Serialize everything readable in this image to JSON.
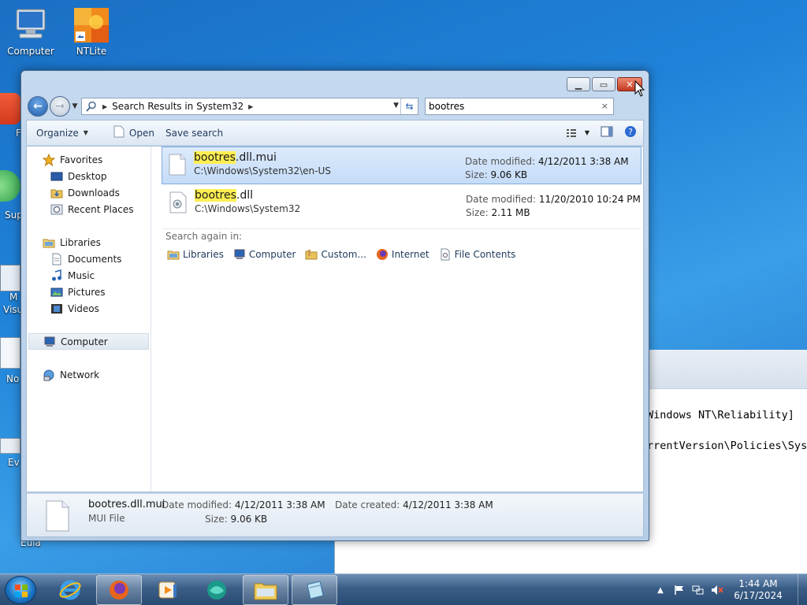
{
  "desktop": {
    "icons": [
      {
        "label": "Computer"
      },
      {
        "label": "NTLite"
      }
    ],
    "partial_labels": [
      "F",
      "Sup",
      "M",
      "Visu",
      "No",
      "Ev",
      "Eula"
    ]
  },
  "console": {
    "lines": [
      "Windows NT\\Reliability]",
      "rrentVersion\\Policies\\Sys"
    ]
  },
  "explorer": {
    "address": {
      "breadcrumb": "Search Results in System32"
    },
    "search": {
      "value": "bootres",
      "clear_glyph": "×"
    },
    "toolbar": {
      "organize": "Organize",
      "open": "Open",
      "save_search": "Save search"
    },
    "nav": {
      "favorites": "Favorites",
      "favorites_items": [
        "Desktop",
        "Downloads",
        "Recent Places"
      ],
      "libraries": "Libraries",
      "libraries_items": [
        "Documents",
        "Music",
        "Pictures",
        "Videos"
      ],
      "computer": "Computer",
      "network": "Network"
    },
    "results": [
      {
        "name_match": "bootres",
        "name_rest": ".dll.mui",
        "path": "C:\\Windows\\System32\\en-US",
        "date_label": "Date modified:",
        "date": "4/12/2011 3:38 AM",
        "size_label": "Size:",
        "size": "9.06 KB",
        "selected": true
      },
      {
        "name_match": "bootres",
        "name_rest": ".dll",
        "path": "C:\\Windows\\System32",
        "date_label": "Date modified:",
        "date": "11/20/2010 10:24 PM",
        "size_label": "Size:",
        "size": "2.11 MB",
        "selected": false
      }
    ],
    "search_again": {
      "label": "Search again in:",
      "items": [
        "Libraries",
        "Computer",
        "Custom...",
        "Internet",
        "File Contents"
      ]
    },
    "details": {
      "name": "bootres.dll.mui",
      "type": "MUI File",
      "modified_label": "Date modified:",
      "modified": "4/12/2011 3:38 AM",
      "size_label": "Size:",
      "size": "9.06 KB",
      "created_label": "Date created:",
      "created": "4/12/2011 3:38 AM"
    }
  },
  "taskbar": {
    "time": "1:44 AM",
    "date": "6/17/2024"
  },
  "colors": {
    "highlight": "#ffee52",
    "selection": "#c5dcf8",
    "taskbar": "#2a4b73"
  }
}
